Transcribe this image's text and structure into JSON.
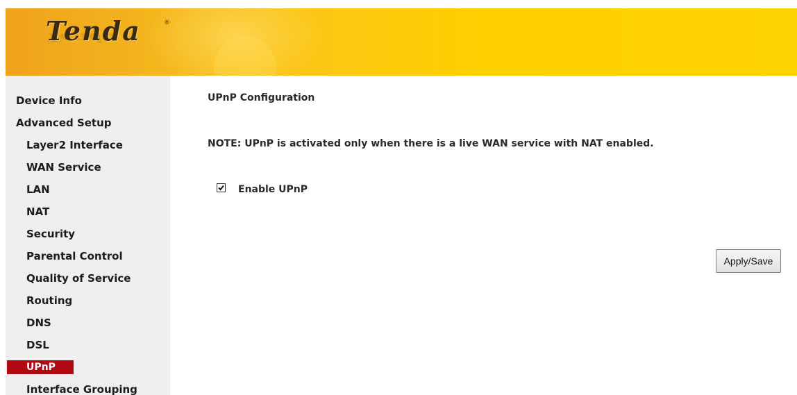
{
  "header": {
    "logo_text": "Tenda",
    "logo_reg_mark": "®"
  },
  "sidebar": {
    "items": [
      {
        "label": "Device Info",
        "level": 1
      },
      {
        "label": "Advanced Setup",
        "level": 1
      },
      {
        "label": "Layer2 Interface",
        "level": 2
      },
      {
        "label": "WAN Service",
        "level": 2
      },
      {
        "label": "LAN",
        "level": 2
      },
      {
        "label": "NAT",
        "level": 2
      },
      {
        "label": "Security",
        "level": 2
      },
      {
        "label": "Parental Control",
        "level": 2
      },
      {
        "label": "Quality of Service",
        "level": 2
      },
      {
        "label": "Routing",
        "level": 2
      },
      {
        "label": "DNS",
        "level": 2
      },
      {
        "label": "DSL",
        "level": 2
      },
      {
        "label": "UPnP",
        "level": 2,
        "active": true
      },
      {
        "label": "Interface Grouping",
        "level": 2
      }
    ]
  },
  "main": {
    "title": "UPnP Configuration",
    "note": "NOTE: UPnP is activated only when there is a live WAN service with NAT enabled.",
    "enable_upnp": {
      "label": "Enable UPnP",
      "checked": true
    },
    "apply_label": "Apply/Save"
  },
  "colors": {
    "header_gold": "#ffd000",
    "header_orange": "#efa21c",
    "sidebar_bg": "#efefef",
    "active_item_bg": "#b10a14",
    "active_item_text": "#ffffff"
  }
}
